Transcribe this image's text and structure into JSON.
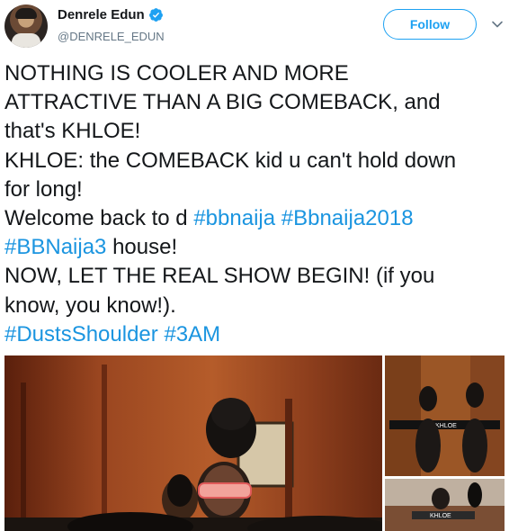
{
  "user": {
    "display_name": "Denrele Edun",
    "handle": "@DENRELE_EDUN",
    "verified": true,
    "avatar_icon": "profile-photo"
  },
  "actions": {
    "follow_label": "Follow",
    "menu_icon": "chevron-down-icon"
  },
  "tweet": {
    "lines": [
      [
        {
          "t": "NOTHING IS COOLER AND MORE",
          "tag": false
        }
      ],
      [
        {
          "t": "ATTRACTIVE THAN A BIG COMEBACK, and",
          "tag": false
        }
      ],
      [
        {
          "t": "that's KHLOE!",
          "tag": false
        }
      ],
      [
        {
          "t": "KHLOE: the COMEBACK kid u can't hold down",
          "tag": false
        }
      ],
      [
        {
          "t": "for long!",
          "tag": false
        }
      ],
      [
        {
          "t": "Welcome back to d ",
          "tag": false
        },
        {
          "t": "#bbnaija",
          "tag": true
        },
        {
          "t": " ",
          "tag": false
        },
        {
          "t": "#Bbnaija2018",
          "tag": true
        }
      ],
      [
        {
          "t": "#BBNaija3",
          "tag": true
        },
        {
          "t": " house!",
          "tag": false
        }
      ],
      [
        {
          "t": "NOW, LET THE REAL SHOW BEGIN! (if you",
          "tag": false
        }
      ],
      [
        {
          "t": "know, you know!).",
          "tag": false
        }
      ],
      [
        {
          "t": "#DustsShoulder",
          "tag": true
        },
        {
          "t": " ",
          "tag": false
        },
        {
          "t": "#3AM",
          "tag": true
        }
      ]
    ]
  },
  "media": {
    "side_top_label": "KHLOE",
    "side_bottom_label": "KHLOE"
  },
  "colors": {
    "accent": "#1da1f2",
    "hashtag": "#1b95e0",
    "muted": "#657786",
    "text": "#14171a"
  }
}
